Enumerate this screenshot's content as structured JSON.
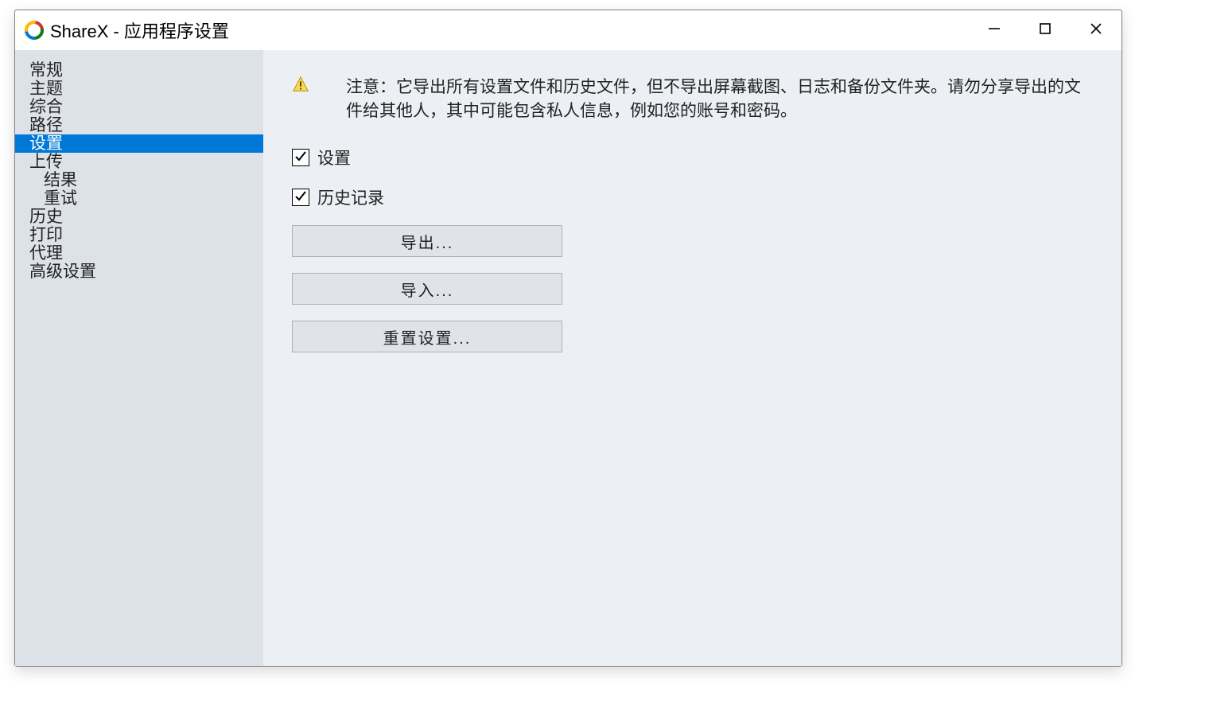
{
  "window": {
    "title": "ShareX - 应用程序设置"
  },
  "sidebar": {
    "items": [
      {
        "label": "常规",
        "depth": 0,
        "selected": false
      },
      {
        "label": "主题",
        "depth": 0,
        "selected": false
      },
      {
        "label": "综合",
        "depth": 0,
        "selected": false
      },
      {
        "label": "路径",
        "depth": 0,
        "selected": false
      },
      {
        "label": "设置",
        "depth": 0,
        "selected": true
      },
      {
        "label": "上传",
        "depth": 0,
        "selected": false
      },
      {
        "label": "结果",
        "depth": 1,
        "selected": false
      },
      {
        "label": "重试",
        "depth": 1,
        "selected": false
      },
      {
        "label": "历史",
        "depth": 0,
        "selected": false
      },
      {
        "label": "打印",
        "depth": 0,
        "selected": false
      },
      {
        "label": "代理",
        "depth": 0,
        "selected": false
      },
      {
        "label": "高级设置",
        "depth": 0,
        "selected": false
      }
    ]
  },
  "content": {
    "warning_text": "注意：它导出所有设置文件和历史文件，但不导出屏幕截图、日志和备份文件夹。请勿分享导出的文件给其他人，其中可能包含私人信息，例如您的账号和密码。",
    "checkbox_settings": {
      "label": "设置",
      "checked": true
    },
    "checkbox_history": {
      "label": "历史记录",
      "checked": true
    },
    "button_export": "导出...",
    "button_import": "导入...",
    "button_reset": "重置设置..."
  }
}
